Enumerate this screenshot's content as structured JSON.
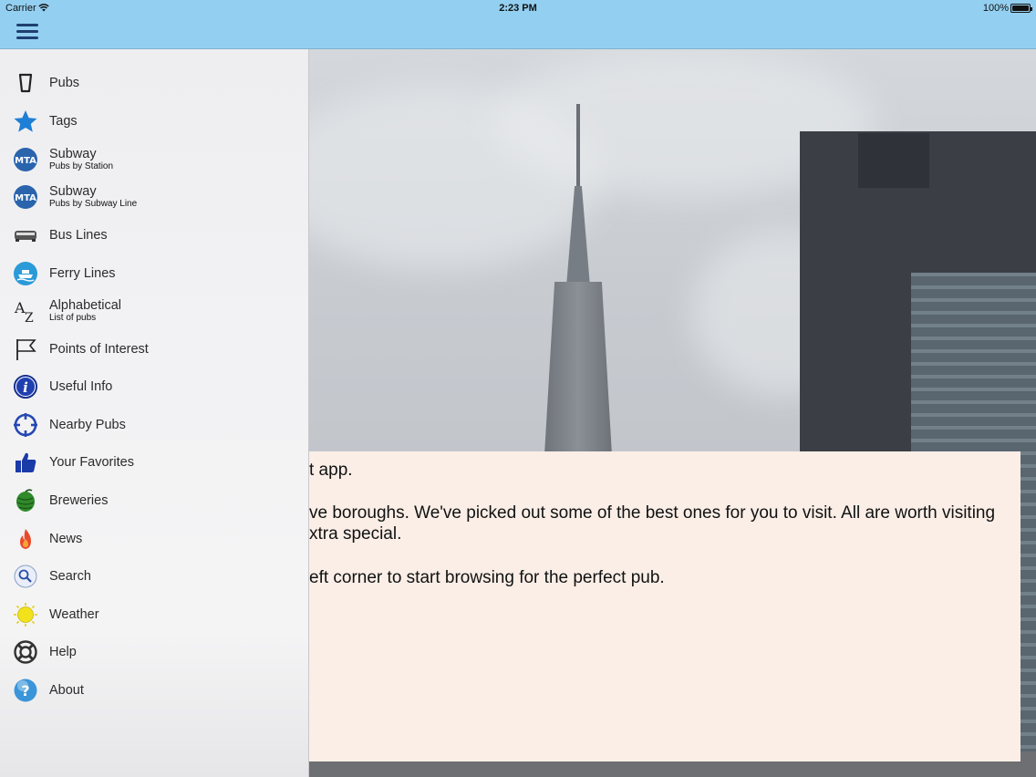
{
  "status": {
    "carrier": "Carrier",
    "time": "2:23 PM",
    "battery_pct": "100%"
  },
  "nav": {
    "menu_icon": "hamburger-icon"
  },
  "sidebar": {
    "items": [
      {
        "label": "Pubs",
        "icon": "pint-glass-icon"
      },
      {
        "label": "Tags",
        "icon": "star-icon"
      },
      {
        "label": "Subway",
        "sub": "Pubs by Station",
        "icon": "mta-icon"
      },
      {
        "label": "Subway",
        "sub": "Pubs by Subway Line",
        "icon": "mta-icon"
      },
      {
        "label": "Bus Lines",
        "icon": "bus-icon"
      },
      {
        "label": "Ferry Lines",
        "icon": "ferry-icon"
      },
      {
        "label": "Alphabetical",
        "sub": "List of pubs",
        "icon": "alphabet-icon"
      },
      {
        "label": "Points of Interest",
        "icon": "flag-icon"
      },
      {
        "label": "Useful Info",
        "icon": "info-icon"
      },
      {
        "label": "Nearby Pubs",
        "icon": "crosshair-icon"
      },
      {
        "label": "Your Favorites",
        "icon": "thumbs-up-icon"
      },
      {
        "label": "Breweries",
        "icon": "hops-icon"
      },
      {
        "label": "News",
        "icon": "flame-icon"
      },
      {
        "label": "Search",
        "icon": "magnifier-icon"
      },
      {
        "label": "Weather",
        "icon": "sun-icon"
      },
      {
        "label": "Help",
        "icon": "lifebuoy-icon"
      },
      {
        "label": "About",
        "icon": "question-icon"
      }
    ]
  },
  "content": {
    "p1": "t app.",
    "p2": "ve boroughs. We've picked out some of the best ones for you to visit. All are worth visiting",
    "p3": "xtra special.",
    "p4": "eft corner to start browsing for the perfect pub."
  },
  "colors": {
    "nav_bg": "#93cff0",
    "menu_icon": "#1f3f6f",
    "card_bg": "#faeee7"
  }
}
